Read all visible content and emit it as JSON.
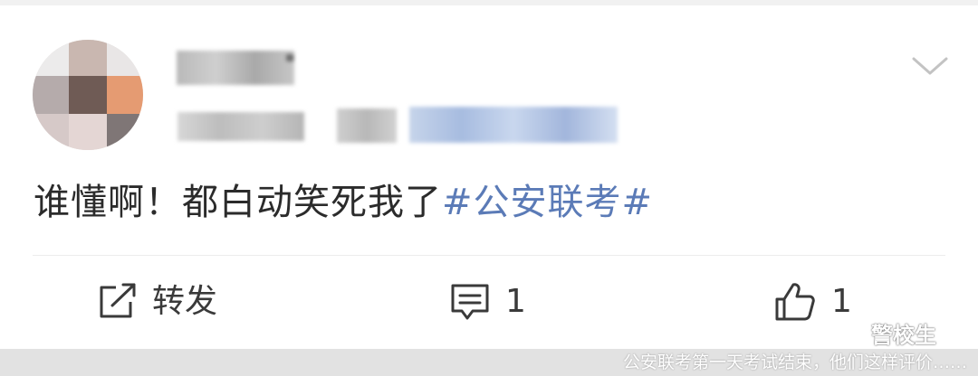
{
  "post": {
    "text": "谁懂啊！都白动笑死我了",
    "hashtag": "#公安联考#"
  },
  "actions": {
    "repost_label": "转发",
    "comment_count": "1",
    "like_count": "1"
  },
  "watermark": {
    "account_name": "警校生"
  },
  "caption": "公安联考第一天考试结束，他们这样评价……",
  "icons": {
    "menu": "chevron-down-icon",
    "repost": "share-icon",
    "comment": "comment-icon",
    "like": "thumbs-up-icon",
    "watermark": "wechat-icon"
  },
  "colors": {
    "hashtag": "#5b7bb7",
    "text": "#2b2b2b",
    "icon": "#3a3a3a"
  }
}
